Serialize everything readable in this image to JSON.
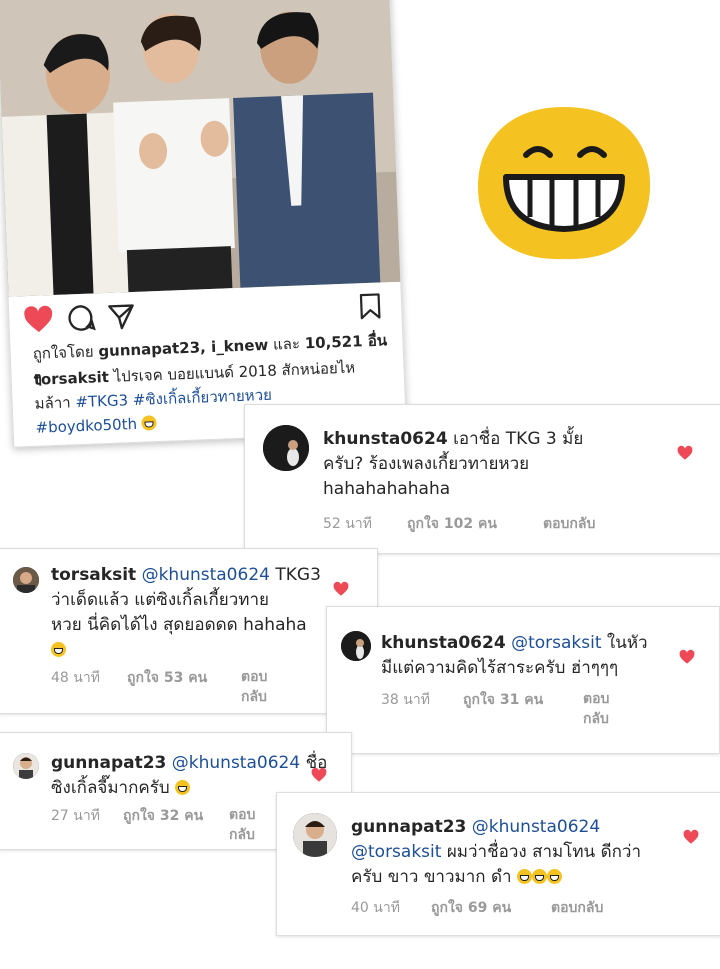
{
  "post": {
    "likes_prefix": "ถูกใจโดย",
    "likes_users": "gunnapat23, i_knew",
    "likes_and": "และ",
    "likes_count": "10,521 อื่น ๆ",
    "caption_user": "torsaksit",
    "caption_text_1": "ไปรเจค บอยแบนด์ 2018 สักหน่อยไห",
    "caption_text_2": "มล้าา",
    "caption_tags_1": "#TKG3 #ซิงเกิ้ลเกี้ยวทายหวย",
    "caption_tags_2": "#boydko50th"
  },
  "comments": [
    {
      "user": "khunsta0624",
      "text_1": "เอาชื่อ TKG 3 มั้ย",
      "text_2": "ครับ? ร้องเพลงเกี้ยวทายหวย",
      "text_3": "hahahahahaha",
      "time": "52 นาที",
      "likes": "ถูกใจ 102 คน",
      "reply": "ตอบกลับ"
    },
    {
      "user": "torsaksit",
      "mention": "@khunsta0624",
      "text_1": "TKG3",
      "text_2": "ว่าเด็ดแล้ว แต่ซิงเกิ้ลเกี้ยวทาย",
      "text_3": "หวย นี่คิดได้ไง สุดยอดดด hahaha",
      "time": "48 นาที",
      "likes": "ถูกใจ 53 คน",
      "reply_1": "ตอบ",
      "reply_2": "กลับ"
    },
    {
      "user": "khunsta0624",
      "mention": "@torsaksit",
      "text_1": "ในหัว",
      "text_2": "มีแต่ความคิดไร้สาระครับ ฮ่าๆๆๆ",
      "time": "38 นาที",
      "likes": "ถูกใจ 31 คน",
      "reply_1": "ตอบ",
      "reply_2": "กลับ"
    },
    {
      "user": "gunnapat23",
      "mention": "@khunsta0624",
      "text_1": "ชื่อ",
      "text_2": "ซิงเกิ้ลจี๊มากครับ",
      "time": "27 นาที",
      "likes": "ถูกใจ 32 คน",
      "reply_1": "ตอบ",
      "reply_2": "กลับ"
    },
    {
      "user": "gunnapat23",
      "mention": "@khunsta0624",
      "mention_2": "@torsaksit",
      "text_1": "ผมว่าชื่อวง สามโทน ดีกว่า",
      "text_2": "ครับ ขาว ขาวมาก ดำ",
      "time": "40 นาที",
      "likes": "ถูกใจ 69 คน",
      "reply": "ตอบกลับ"
    }
  ],
  "colors": {
    "heart": "#ed4956",
    "tag": "#1e4f96",
    "emoji": "#f5c321"
  }
}
